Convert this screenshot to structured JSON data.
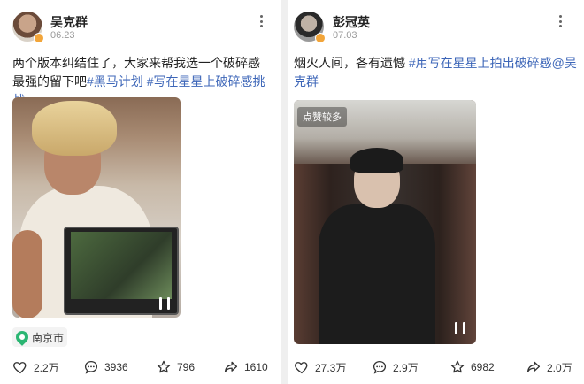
{
  "posts": [
    {
      "author": "吴克群",
      "date": "06.23",
      "text": "两个版本纠结住了，大家来帮我选一个破碎感最强的留下吧",
      "tags": [
        "#黑马计划",
        "#写在星星上破碎感挑战"
      ],
      "location": "南京市",
      "stats": {
        "likes": "2.2万",
        "comments": "3936",
        "favorites": "796",
        "shares": "1610"
      }
    },
    {
      "author": "彭冠英",
      "date": "07.03",
      "text": "烟火人间，各有遗憾",
      "tags": [
        "#用写在星星上拍出破碎感@"
      ],
      "mention": "吴克群",
      "media_badge": "点赞较多",
      "stats": {
        "likes": "27.3万",
        "comments": "2.9万",
        "favorites": "6982",
        "shares": "2.0万"
      }
    }
  ],
  "colors": {
    "tag": "#3d66b8",
    "verified": "#f2a53a",
    "location_pin": "#2bb673"
  }
}
